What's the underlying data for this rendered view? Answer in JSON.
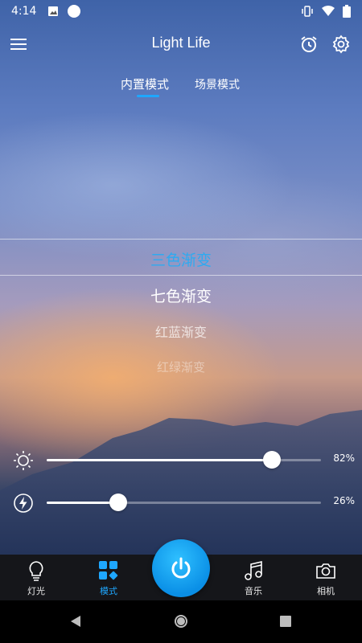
{
  "status_bar": {
    "time": "4:14"
  },
  "header": {
    "title": "Light Life",
    "menu_icon": "menu-icon",
    "alarm_icon": "alarm-icon",
    "settings_icon": "gear-icon"
  },
  "tabs": [
    {
      "label": "内置模式",
      "active": true
    },
    {
      "label": "场景模式",
      "active": false
    }
  ],
  "modes": [
    {
      "label": "三色渐变",
      "selected": true
    },
    {
      "label": "七色渐变"
    },
    {
      "label": "红蓝渐变"
    },
    {
      "label": "红绿渐变"
    }
  ],
  "sliders": {
    "brightness": {
      "value": 82,
      "label": "82%",
      "icon": "sun-icon"
    },
    "speed": {
      "value": 26,
      "label": "26%",
      "icon": "lightning-icon"
    }
  },
  "bottom_nav": [
    {
      "label": "灯光",
      "icon": "bulb-icon",
      "active": false
    },
    {
      "label": "模式",
      "icon": "mode-grid-icon",
      "active": true
    },
    {
      "label": "音乐",
      "icon": "music-note-icon",
      "active": false
    },
    {
      "label": "相机",
      "icon": "camera-icon",
      "active": false
    }
  ],
  "colors": {
    "accent": "#1ea7ff",
    "nav_bg": "#15161a",
    "power_button": "#0a8fe6"
  }
}
